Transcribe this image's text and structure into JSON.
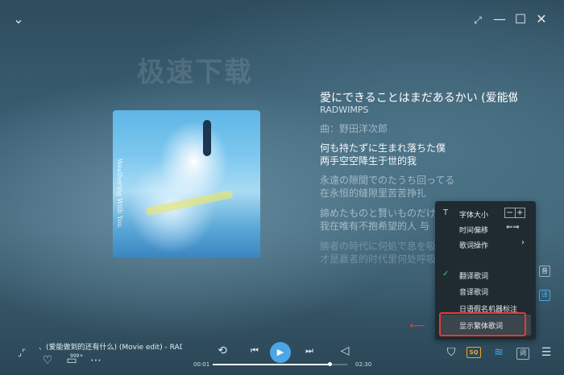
{
  "watermark": "极速下载",
  "album": {
    "vertical_text": "Weathering With You"
  },
  "song": {
    "title": "愛にできることはまだあるかい (爱能做…",
    "artist": "RADWIMPS"
  },
  "lyrics": {
    "composer": "曲：野田洋次郎",
    "lines": [
      "何も持たずに生まれ落ちた僕",
      "两手空空降生于世的我",
      "永遠の隙間でのたうち回ってる",
      "在永恒的缝隙里苦苦挣扎",
      "諦めたものと賢いものだけ",
      "我在唯有不抱希望的人 与",
      "勝者の時代に何処で息を吸う",
      "才是赢者的时代里何处呼吸"
    ]
  },
  "menu": {
    "font_size": "字体大小",
    "font_minus": "−",
    "font_plus": "+",
    "time_offset": "时间偏移",
    "lyric_ops": "歌词操作",
    "translate": "翻译歌词",
    "phonetic": "音译歌词",
    "kana": "日语假名机器标注",
    "traditional": "显示繁体歌词"
  },
  "side_buttons": {
    "a": "音",
    "b": "译"
  },
  "player": {
    "now_playing": "、(爱能做到的还有什么) (Movie edit) - RAD",
    "comment_count": "999+",
    "elapsed": "00:01",
    "total": "02:30",
    "progress": 0.87,
    "quality": "SQ",
    "lyric_btn": "词"
  },
  "colors": {
    "accent": "#4aa6e6",
    "highlight_box": "#e53935",
    "check": "#4ec47a",
    "quality": "#f0a030"
  }
}
